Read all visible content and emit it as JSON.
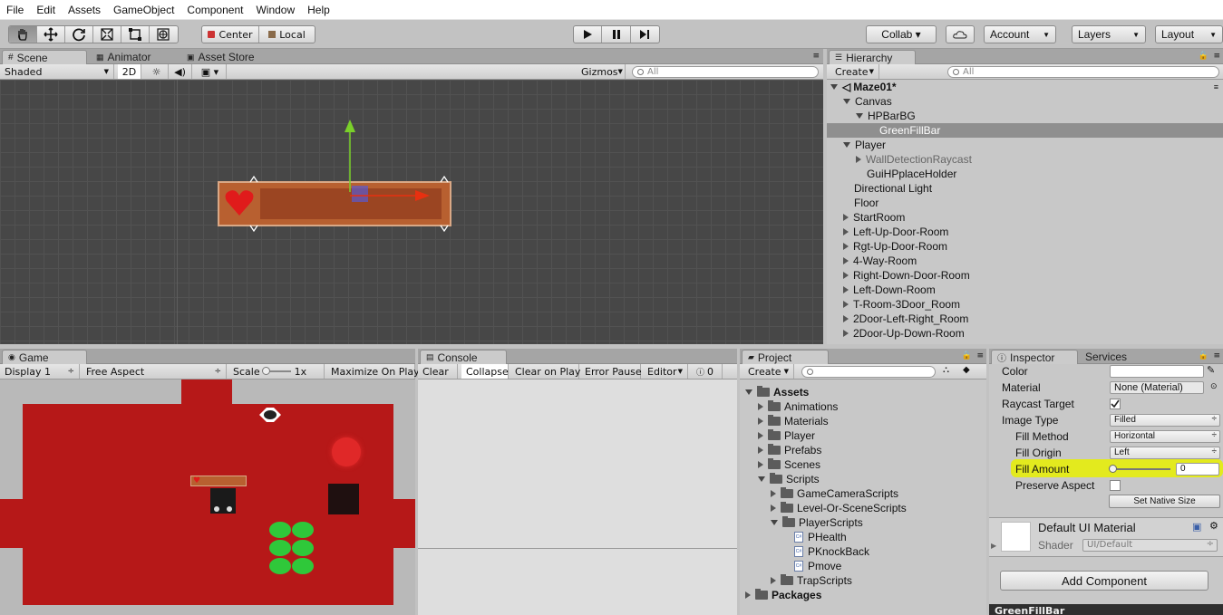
{
  "menu": [
    "File",
    "Edit",
    "Assets",
    "GameObject",
    "Component",
    "Window",
    "Help"
  ],
  "toolbar": {
    "tools": [
      "hand-tool",
      "move-tool",
      "rotate-tool",
      "scale-tool",
      "rect-tool",
      "transform-tool"
    ],
    "pivot": "Center",
    "space": "Local",
    "collab": "Collab ▾",
    "account": "Account",
    "layers": "Layers",
    "layout": "Layout"
  },
  "scene": {
    "tabs": [
      "Scene",
      "Animator",
      "Asset Store"
    ],
    "shading": "Shaded",
    "mode2d": "2D",
    "gizmos": "Gizmos",
    "search": "All"
  },
  "hierarchy": {
    "tab": "Hierarchy",
    "create": "Create",
    "search": "All",
    "scene": "Maze01*",
    "items": [
      "Canvas",
      "HPBarBG",
      "GreenFillBar",
      "Player",
      "WallDetectionRaycast",
      "GuiHPplaceHolder",
      "Directional Light",
      "Floor",
      "StartRoom",
      "Left-Up-Door-Room",
      "Rgt-Up-Door-Room",
      "4-Way-Room",
      "Right-Down-Door-Room",
      "Left-Down-Room",
      "T-Room-3Door_Room",
      "2Door-Left-Right_Room",
      "2Door-Up-Down-Room"
    ]
  },
  "game": {
    "tab": "Game",
    "display": "Display 1",
    "aspect": "Free Aspect",
    "scale_label": "Scale",
    "scale_value": "1x",
    "maximize": "Maximize On Play"
  },
  "console": {
    "tab": "Console",
    "buttons": [
      "Clear",
      "Collapse",
      "Clear on Play",
      "Error Pause",
      "Editor"
    ],
    "count": "0"
  },
  "project": {
    "tab": "Project",
    "create": "Create",
    "items": [
      "Assets",
      "Animations",
      "Materials",
      "Player",
      "Prefabs",
      "Scenes",
      "Scripts",
      "GameCameraScripts",
      "Level-Or-SceneScripts",
      "PlayerScripts",
      "PHealth",
      "PKnockBack",
      "Pmove",
      "TrapScripts",
      "Packages"
    ]
  },
  "inspector": {
    "tabs": [
      "Inspector",
      "Services"
    ],
    "color_label": "Color",
    "material_label": "Material",
    "material_value": "None (Material)",
    "raycast_label": "Raycast Target",
    "image_type_label": "Image Type",
    "image_type_value": "Filled",
    "fill_method_label": "Fill Method",
    "fill_method_value": "Horizontal",
    "fill_origin_label": "Fill Origin",
    "fill_origin_value": "Left",
    "fill_amount_label": "Fill Amount",
    "fill_amount_value": "0",
    "fill_amount": 0,
    "preserve_label": "Preserve Aspect",
    "native_size": "Set Native Size",
    "material_name": "Default UI Material",
    "shader_label": "Shader",
    "shader_value": "UI/Default",
    "add_component": "Add Component",
    "footer": "GreenFillBar"
  },
  "colors": {
    "highlight": "#e8f000",
    "floor": "#b61818",
    "bar": "#b86030"
  }
}
